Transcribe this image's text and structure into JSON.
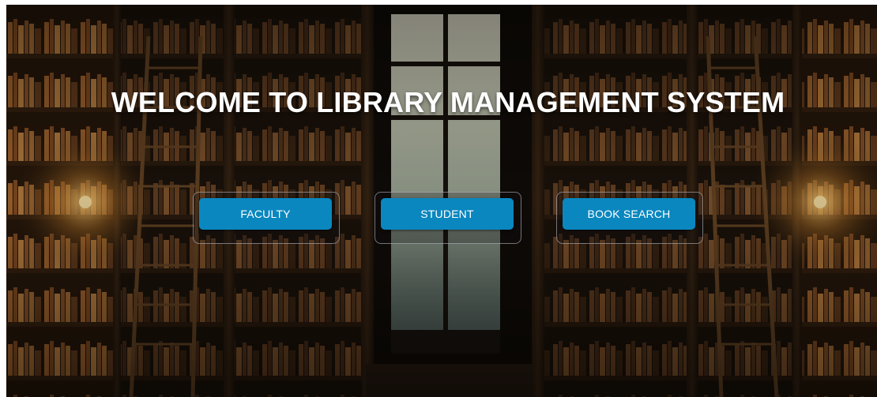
{
  "page": {
    "heading": "WELCOME TO LIBRARY MANAGEMENT SYSTEM",
    "background_image": "library-bookshelves-with-window"
  },
  "nav": {
    "buttons": [
      {
        "label": "FACULTY"
      },
      {
        "label": "STUDENT"
      },
      {
        "label": "BOOK SEARCH"
      }
    ]
  },
  "colors": {
    "button_bg": "#0a87bf",
    "button_text": "#ffffff",
    "heading_text": "#ffffff"
  }
}
